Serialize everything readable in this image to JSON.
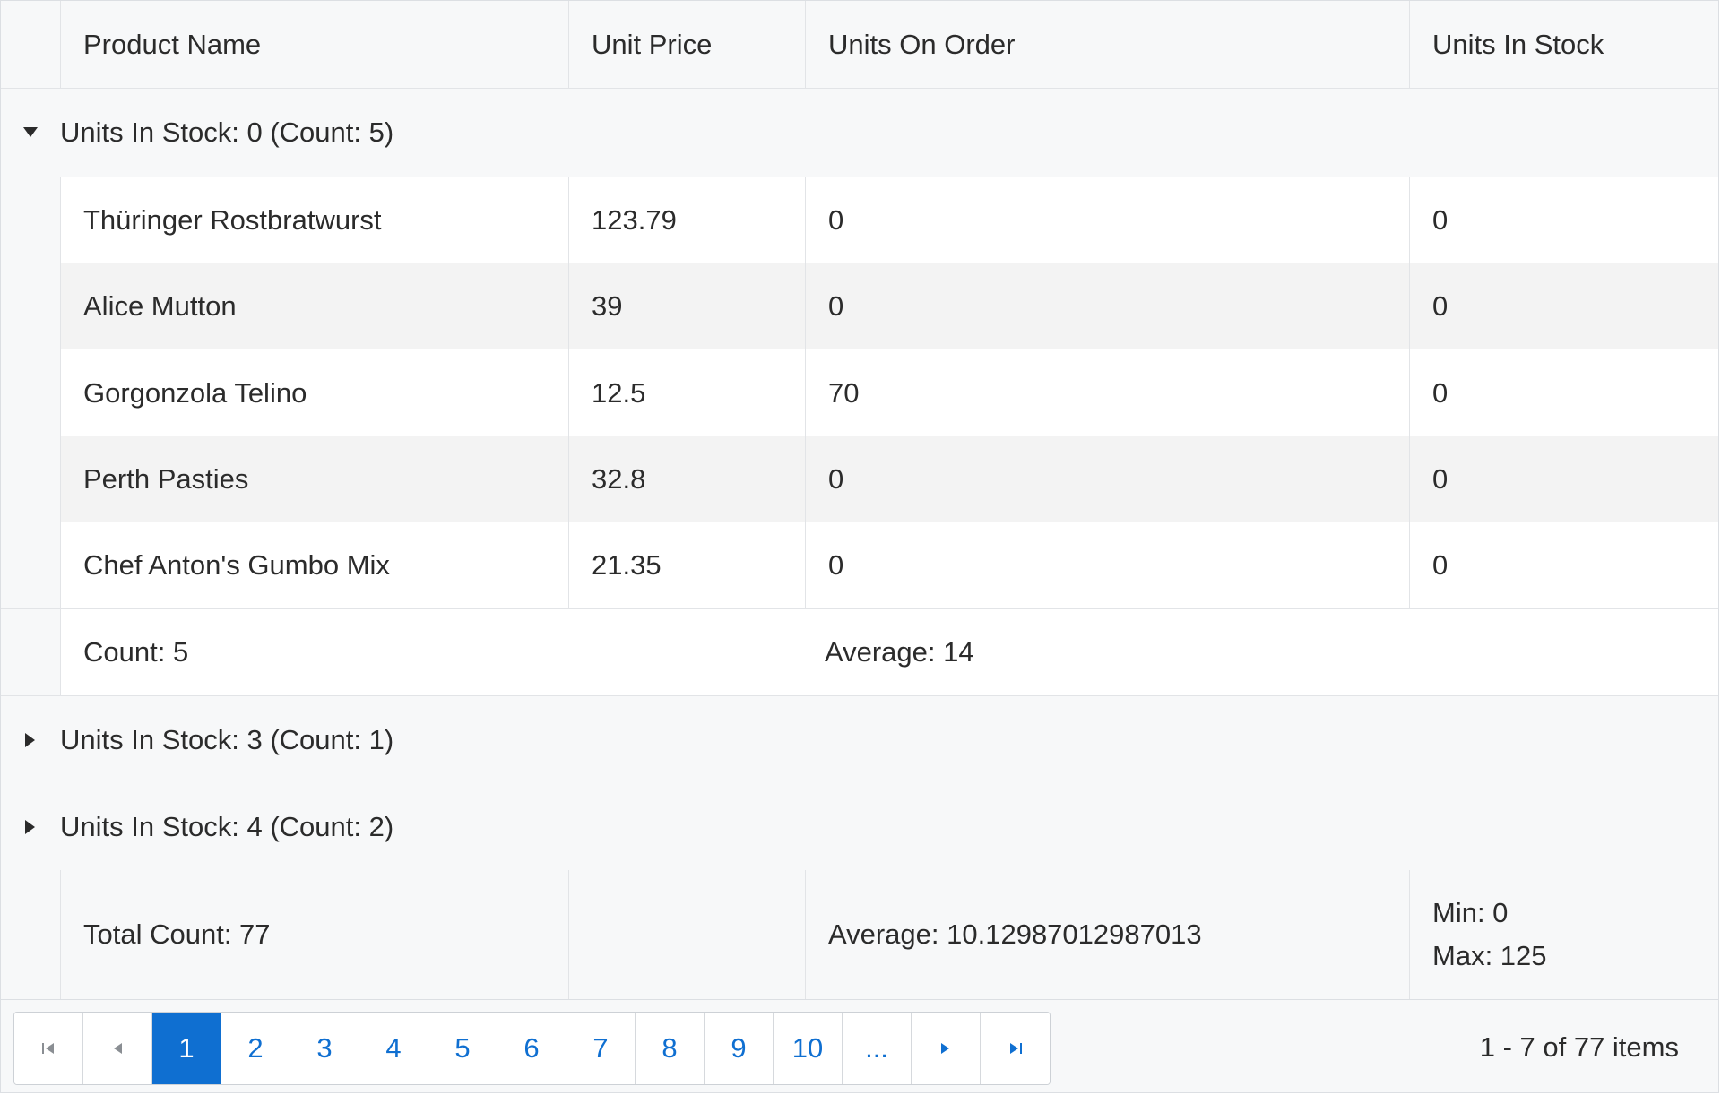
{
  "columns": {
    "product_name": "Product Name",
    "unit_price": "Unit Price",
    "units_on_order": "Units On Order",
    "units_in_stock": "Units In Stock"
  },
  "groups": [
    {
      "label": "Units In Stock: 0 (Count: 5)",
      "expanded": true,
      "rows": [
        {
          "name": "Thüringer Rostbratwurst",
          "price": "123.79",
          "on_order": "0",
          "in_stock": "0"
        },
        {
          "name": "Alice Mutton",
          "price": "39",
          "on_order": "0",
          "in_stock": "0"
        },
        {
          "name": "Gorgonzola Telino",
          "price": "12.5",
          "on_order": "70",
          "in_stock": "0"
        },
        {
          "name": "Perth Pasties",
          "price": "32.8",
          "on_order": "0",
          "in_stock": "0"
        },
        {
          "name": "Chef Anton's Gumbo Mix",
          "price": "21.35",
          "on_order": "0",
          "in_stock": "0"
        }
      ],
      "footer": {
        "count": "Count: 5",
        "average": "Average: 14"
      }
    },
    {
      "label": "Units In Stock: 3 (Count: 1)",
      "expanded": false
    },
    {
      "label": "Units In Stock: 4 (Count: 2)",
      "expanded": false
    }
  ],
  "totals": {
    "count": "Total Count: 77",
    "average": "Average: 10.12987012987013",
    "min": "Min: 0",
    "max": "Max: 125"
  },
  "pager": {
    "pages": [
      "1",
      "2",
      "3",
      "4",
      "5",
      "6",
      "7",
      "8",
      "9",
      "10",
      "..."
    ],
    "active_page": "1",
    "info": "1 - 7 of 77 items"
  },
  "colors": {
    "accent": "#0f6fd1",
    "header_bg": "#f7f8f9",
    "alt_row_bg": "#f3f3f3"
  }
}
